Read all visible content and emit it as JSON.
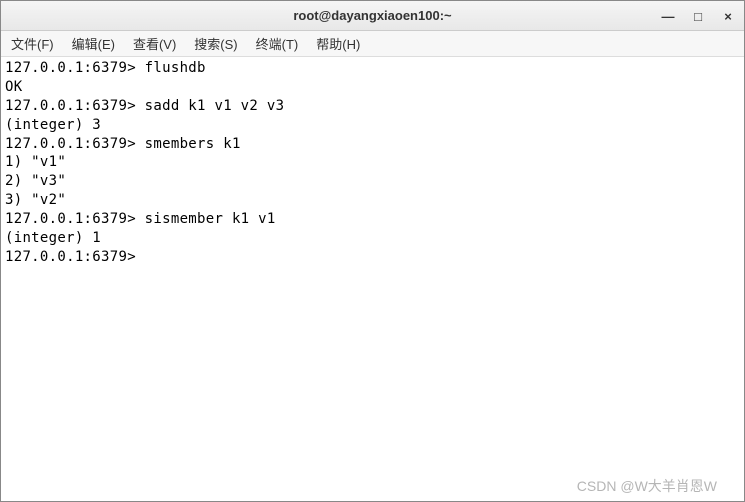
{
  "window": {
    "title": "root@dayangxiaoen100:~"
  },
  "controls": {
    "minimize": "—",
    "maximize": "□",
    "close": "×"
  },
  "menu": {
    "file": "文件(F)",
    "edit": "编辑(E)",
    "view": "查看(V)",
    "search": "搜索(S)",
    "terminal": "终端(T)",
    "help": "帮助(H)"
  },
  "terminal": {
    "lines": {
      "l0": "127.0.0.1:6379> flushdb",
      "l1": "OK",
      "l2": "127.0.0.1:6379> sadd k1 v1 v2 v3",
      "l3": "(integer) 3",
      "l4": "127.0.0.1:6379> smembers k1",
      "l5": "1) \"v1\"",
      "l6": "2) \"v3\"",
      "l7": "3) \"v2\"",
      "l8": "127.0.0.1:6379> sismember k1 v1",
      "l9": "(integer) 1",
      "l10": "127.0.0.1:6379> "
    }
  },
  "watermark": "CSDN @W大羊肖恩W"
}
